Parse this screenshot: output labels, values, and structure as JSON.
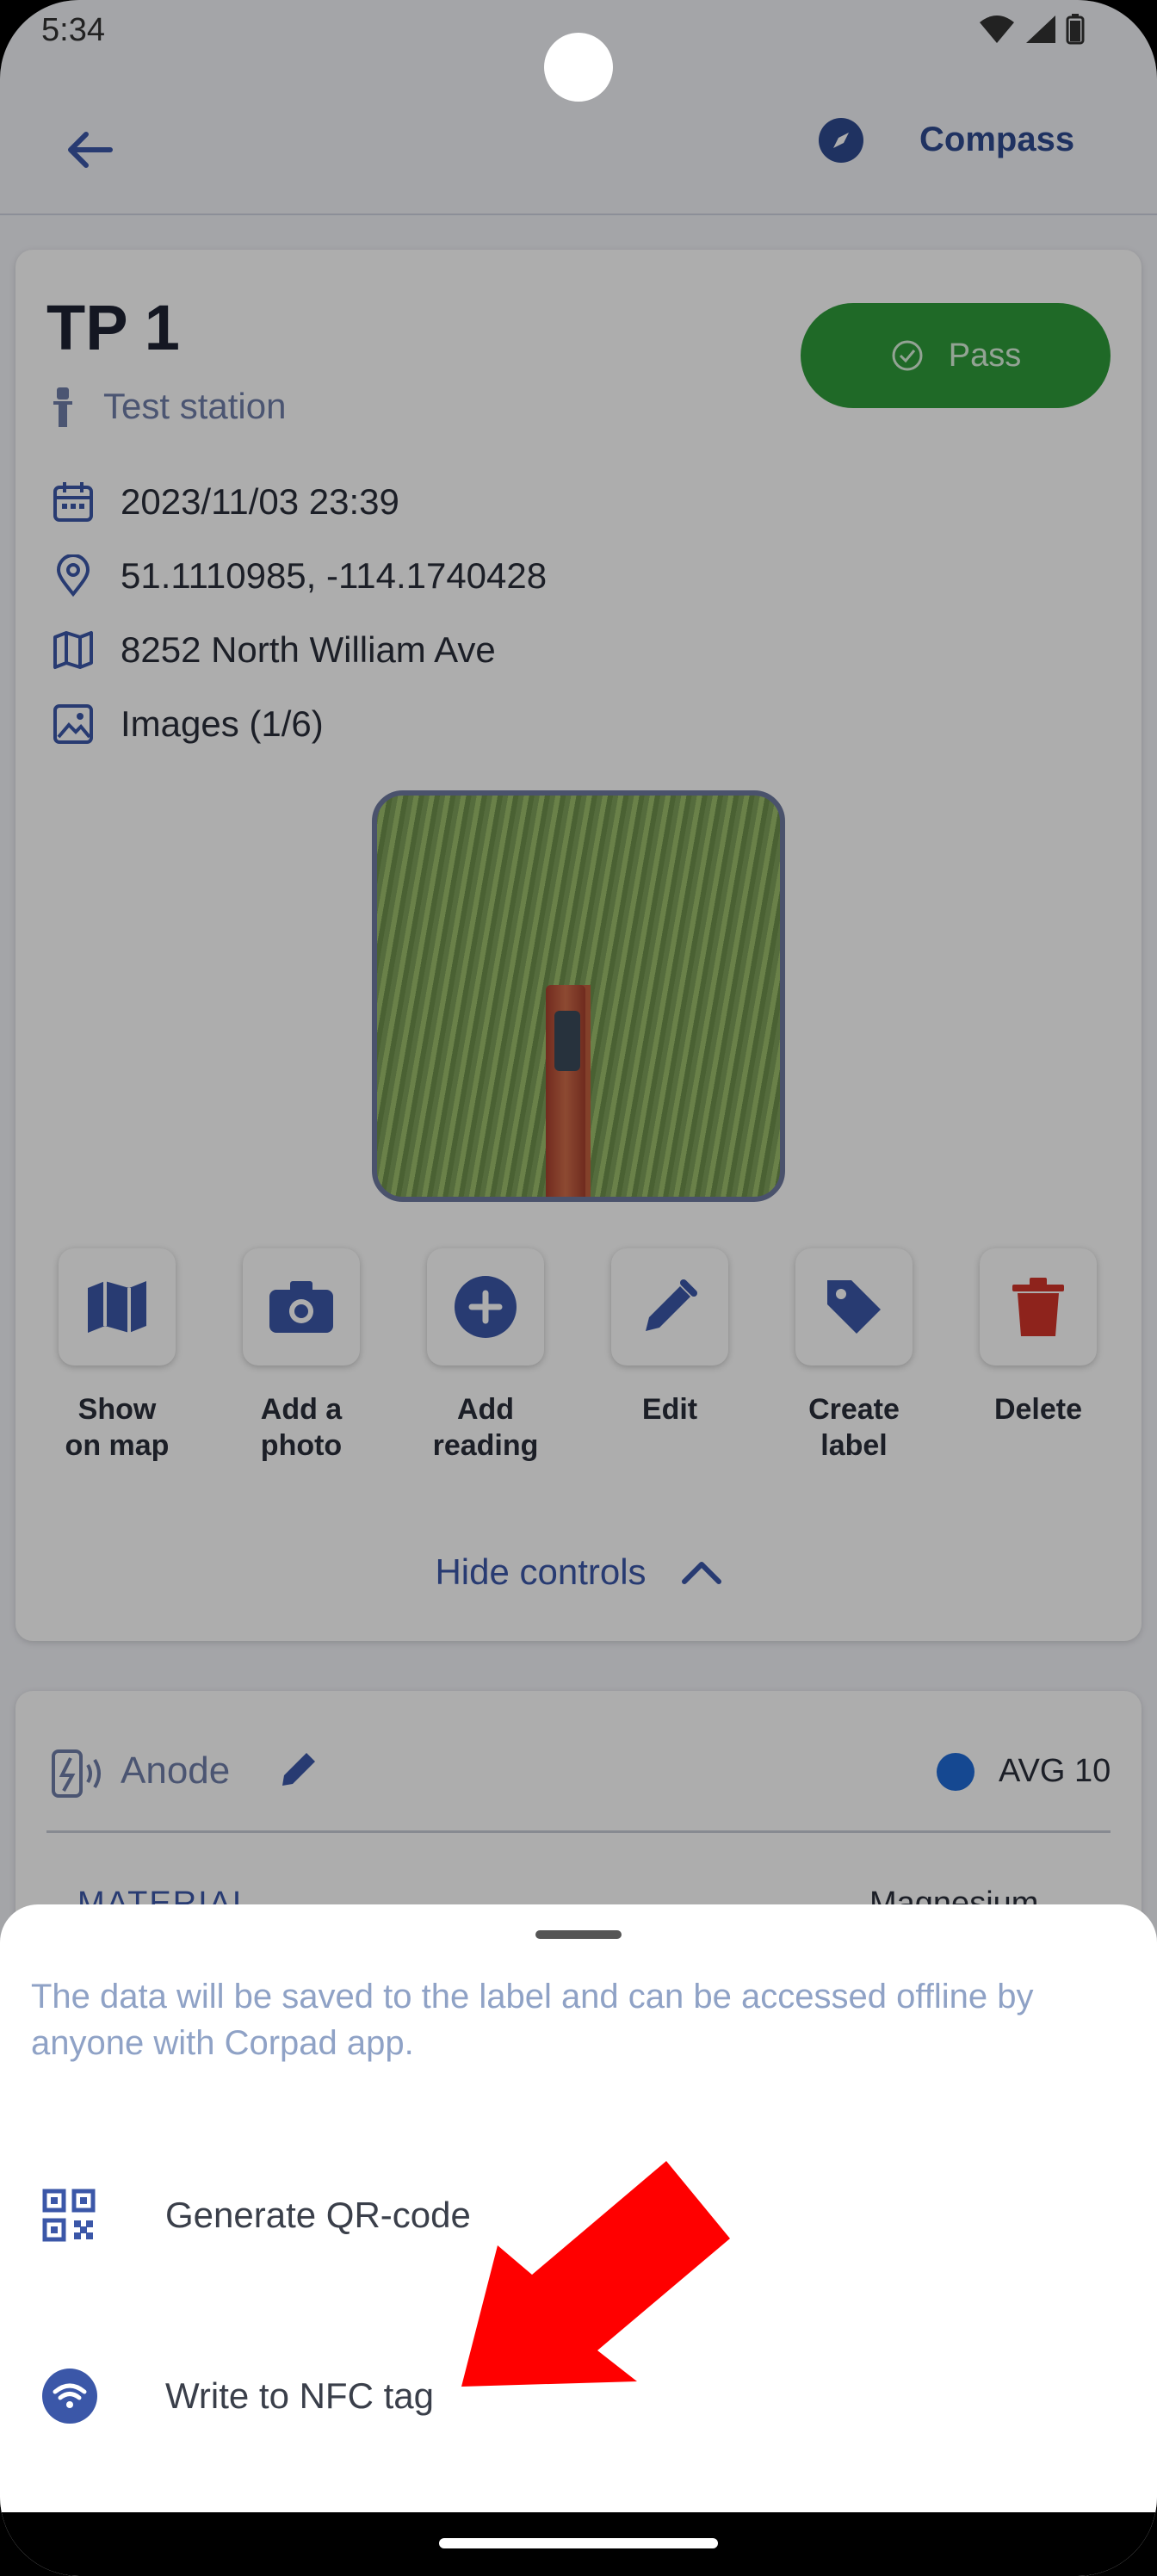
{
  "status_bar": {
    "time": "5:34"
  },
  "app_bar": {
    "back_icon": "arrow-left-icon",
    "compass_label": "Compass"
  },
  "station": {
    "title": "TP 1",
    "type": "Test station",
    "status_label": "Pass",
    "date": "2023/11/03 23:39",
    "coordinates": "51.1110985, -114.1740428",
    "address": "8252 North William Ave",
    "images": "Images (1/6)"
  },
  "actions": [
    {
      "label": "Show on map",
      "icon": "map-icon"
    },
    {
      "label": "Add a photo",
      "icon": "camera-icon"
    },
    {
      "label": "Add reading",
      "icon": "plus-circle-icon"
    },
    {
      "label": "Edit",
      "icon": "pencil-icon"
    },
    {
      "label": "Create label",
      "icon": "tag-icon"
    },
    {
      "label": "Delete",
      "icon": "trash-icon"
    }
  ],
  "hide_controls_label": "Hide controls",
  "anode": {
    "label": "Anode",
    "avg_label": "AVG 10",
    "material_label": "MATERIAL",
    "material_value": "Magnesium"
  },
  "sheet": {
    "description": "The data will be saved to the label and can be accessed offline by anyone with Corpad app.",
    "items": [
      {
        "label": "Generate QR-code",
        "icon": "qr-code-icon"
      },
      {
        "label": "Write to NFC tag",
        "icon": "nfc-icon"
      }
    ]
  },
  "colors": {
    "accent": "#3b57a8",
    "pass": "#2f9b3a",
    "delete": "#d2342a",
    "arrow": "#ff0000"
  }
}
